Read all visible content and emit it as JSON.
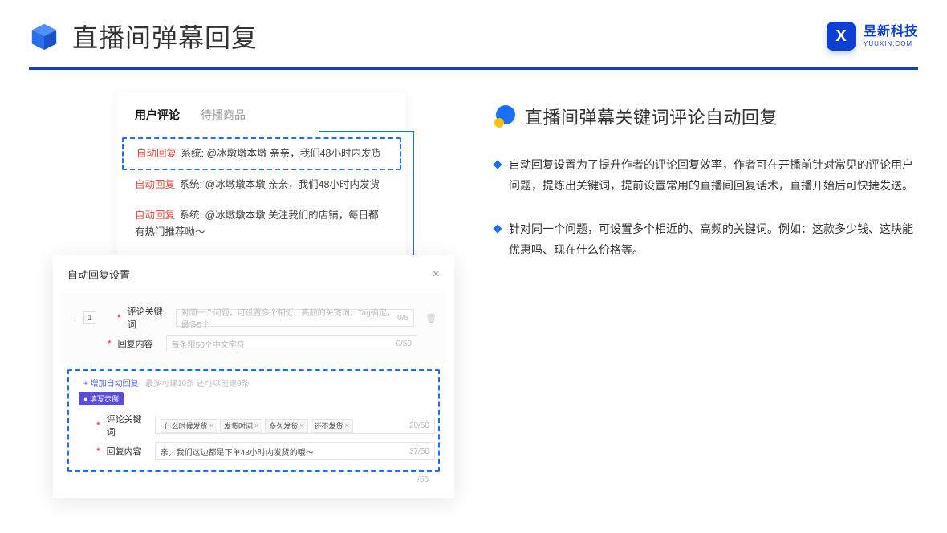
{
  "page_title": "直播间弹幕回复",
  "brand": {
    "cn": "昱新科技",
    "en": "YUUXIN.COM",
    "logo_letter": "X"
  },
  "comments_card": {
    "tabs": [
      "用户评论",
      "待播商品"
    ],
    "active_tab": 0,
    "rows": [
      {
        "tag": "自动回复",
        "text": "系统: @冰墩墩本墩 亲亲，我们48小时内发货"
      },
      {
        "tag": "自动回复",
        "text": "系统: @冰墩墩本墩 亲亲，我们48小时内发货"
      },
      {
        "tag": "自动回复",
        "text": "系统: @冰墩墩本墩 关注我们的店铺，每日都有热门推荐呦～"
      }
    ]
  },
  "settings_card": {
    "title": "自动回复设置",
    "close": "×",
    "order": "1",
    "labels": {
      "keyword": "评论关键词",
      "content": "回复内容"
    },
    "placeholders": {
      "keyword": "对同一个问题，可设置多个相近、高频的关键词，Tag确定，最多5个",
      "content": "每条限50个中文字符"
    },
    "counts": {
      "keyword": "0/5",
      "content": "0/50",
      "ex_keyword": "20/50",
      "ex_content": "37/50",
      "extra": "/50"
    },
    "add_link": "+ 增加自动回复",
    "add_hint": "最多可建10条 还可以创建9条",
    "example_badge": "● 填写示例",
    "example_tags": [
      "什么时候发货",
      "发货时间",
      "多久发货",
      "还不发货"
    ],
    "example_content": "亲，我们这边都是下单48小时内发货的哦～"
  },
  "right": {
    "section_heading": "直播间弹幕关键词评论自动回复",
    "bullets": [
      "自动回复设置为了提升作者的评论回复效率，作者可在开播前针对常见的评论用户问题，提炼出关键词，提前设置常用的直播间回复话术，直播开始后可快捷发送。",
      "针对同一个问题，可设置多个相近的、高频的关键词。例如：这款多少钱、这块能优惠吗、现在什么价格等。"
    ]
  }
}
